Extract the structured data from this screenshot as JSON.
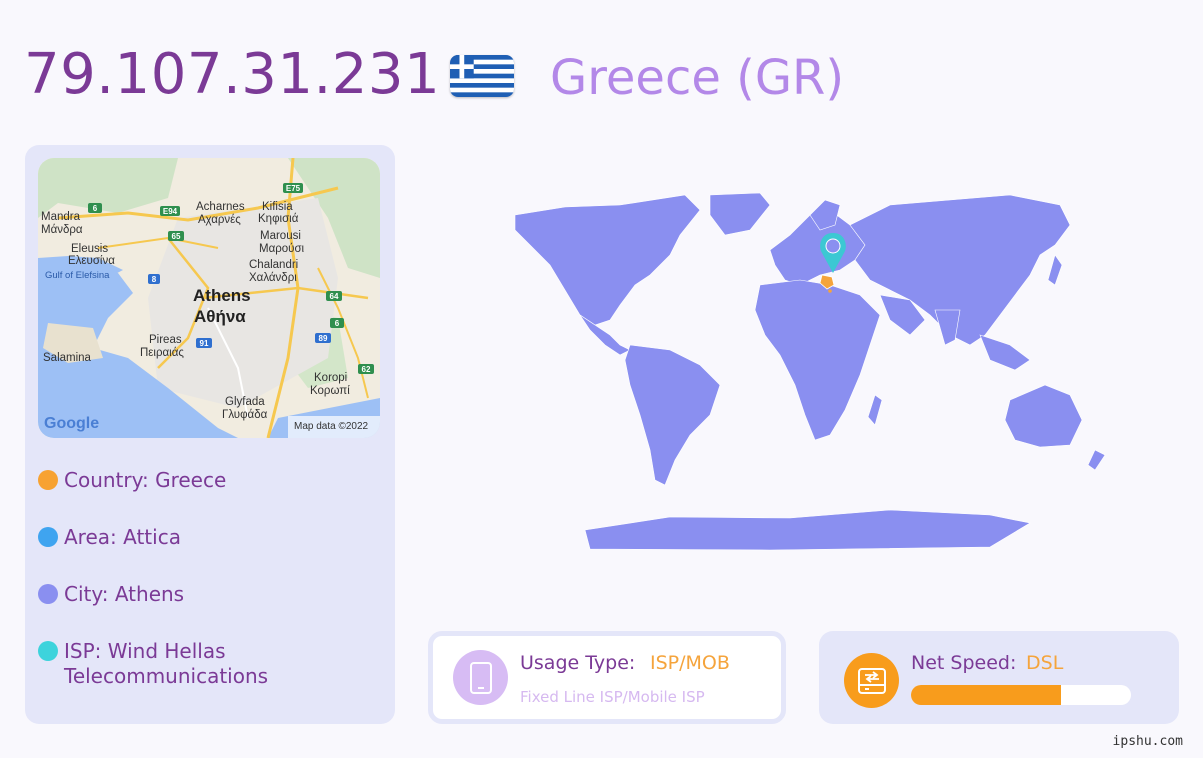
{
  "header": {
    "ip": "79.107.31.231",
    "country_title": "Greece (GR)",
    "flag": "greece-flag"
  },
  "map": {
    "labels": {
      "mandra": "Mandra",
      "mandra_gr": "Μάνδρα",
      "acharnes": "Acharnes",
      "acharnes_gr": "Αχαρνές",
      "kifisia": "Kifisia",
      "kifisia_gr": "Κηφισιά",
      "eleusis": "Eleusis",
      "eleusis_gr": "Ελευσίνα",
      "marousi": "Marousi",
      "marousi_gr": "Μαρούσι",
      "gulf": "Gulf of Elefsina",
      "chalandri": "Chalandri",
      "chalandri_gr": "Χαλάνδρι",
      "athens": "Athens",
      "athens_gr": "Αθήνα",
      "pireas": "Pireas",
      "pireas_gr": "Πειραιάς",
      "salamina": "Salamina",
      "koropi": "Koropi",
      "koropi_gr": "Κορωπί",
      "glyfada": "Glyfada",
      "glyfada_gr": "Γλυφάδα",
      "google": "Google",
      "attribution": "Map data ©2022"
    },
    "road_shields": [
      "E75",
      "6",
      "E94",
      "65",
      "8",
      "64",
      "6",
      "89",
      "91",
      "62"
    ]
  },
  "info": {
    "country": "Country: Greece",
    "area": "Area: Attica",
    "city": "City: Athens",
    "isp_line1": "ISP: Wind Hellas",
    "isp_line2": "Telecommunications"
  },
  "usage": {
    "label": "Usage Type:",
    "value": "ISP/MOB",
    "sub": "Fixed Line ISP/Mobile ISP",
    "icon": "mobile-phone-icon"
  },
  "speed": {
    "label": "Net Speed:",
    "value": "DSL",
    "icon": "network-drive-icon",
    "level": 0.68
  },
  "watermark": "ipshu.com",
  "colors": {
    "ip": "#7b3a96",
    "country_title": "#b388e8",
    "panel_bg": "#e4e6f9",
    "country_dot": "#f7a232",
    "area_dot": "#3fa4f0",
    "city_dot": "#8a8ff0",
    "isp_dot": "#3dd3dc",
    "land": "#8a8ff0",
    "marker": "#3cc8d3",
    "speed_bar": "#f89c1c"
  }
}
